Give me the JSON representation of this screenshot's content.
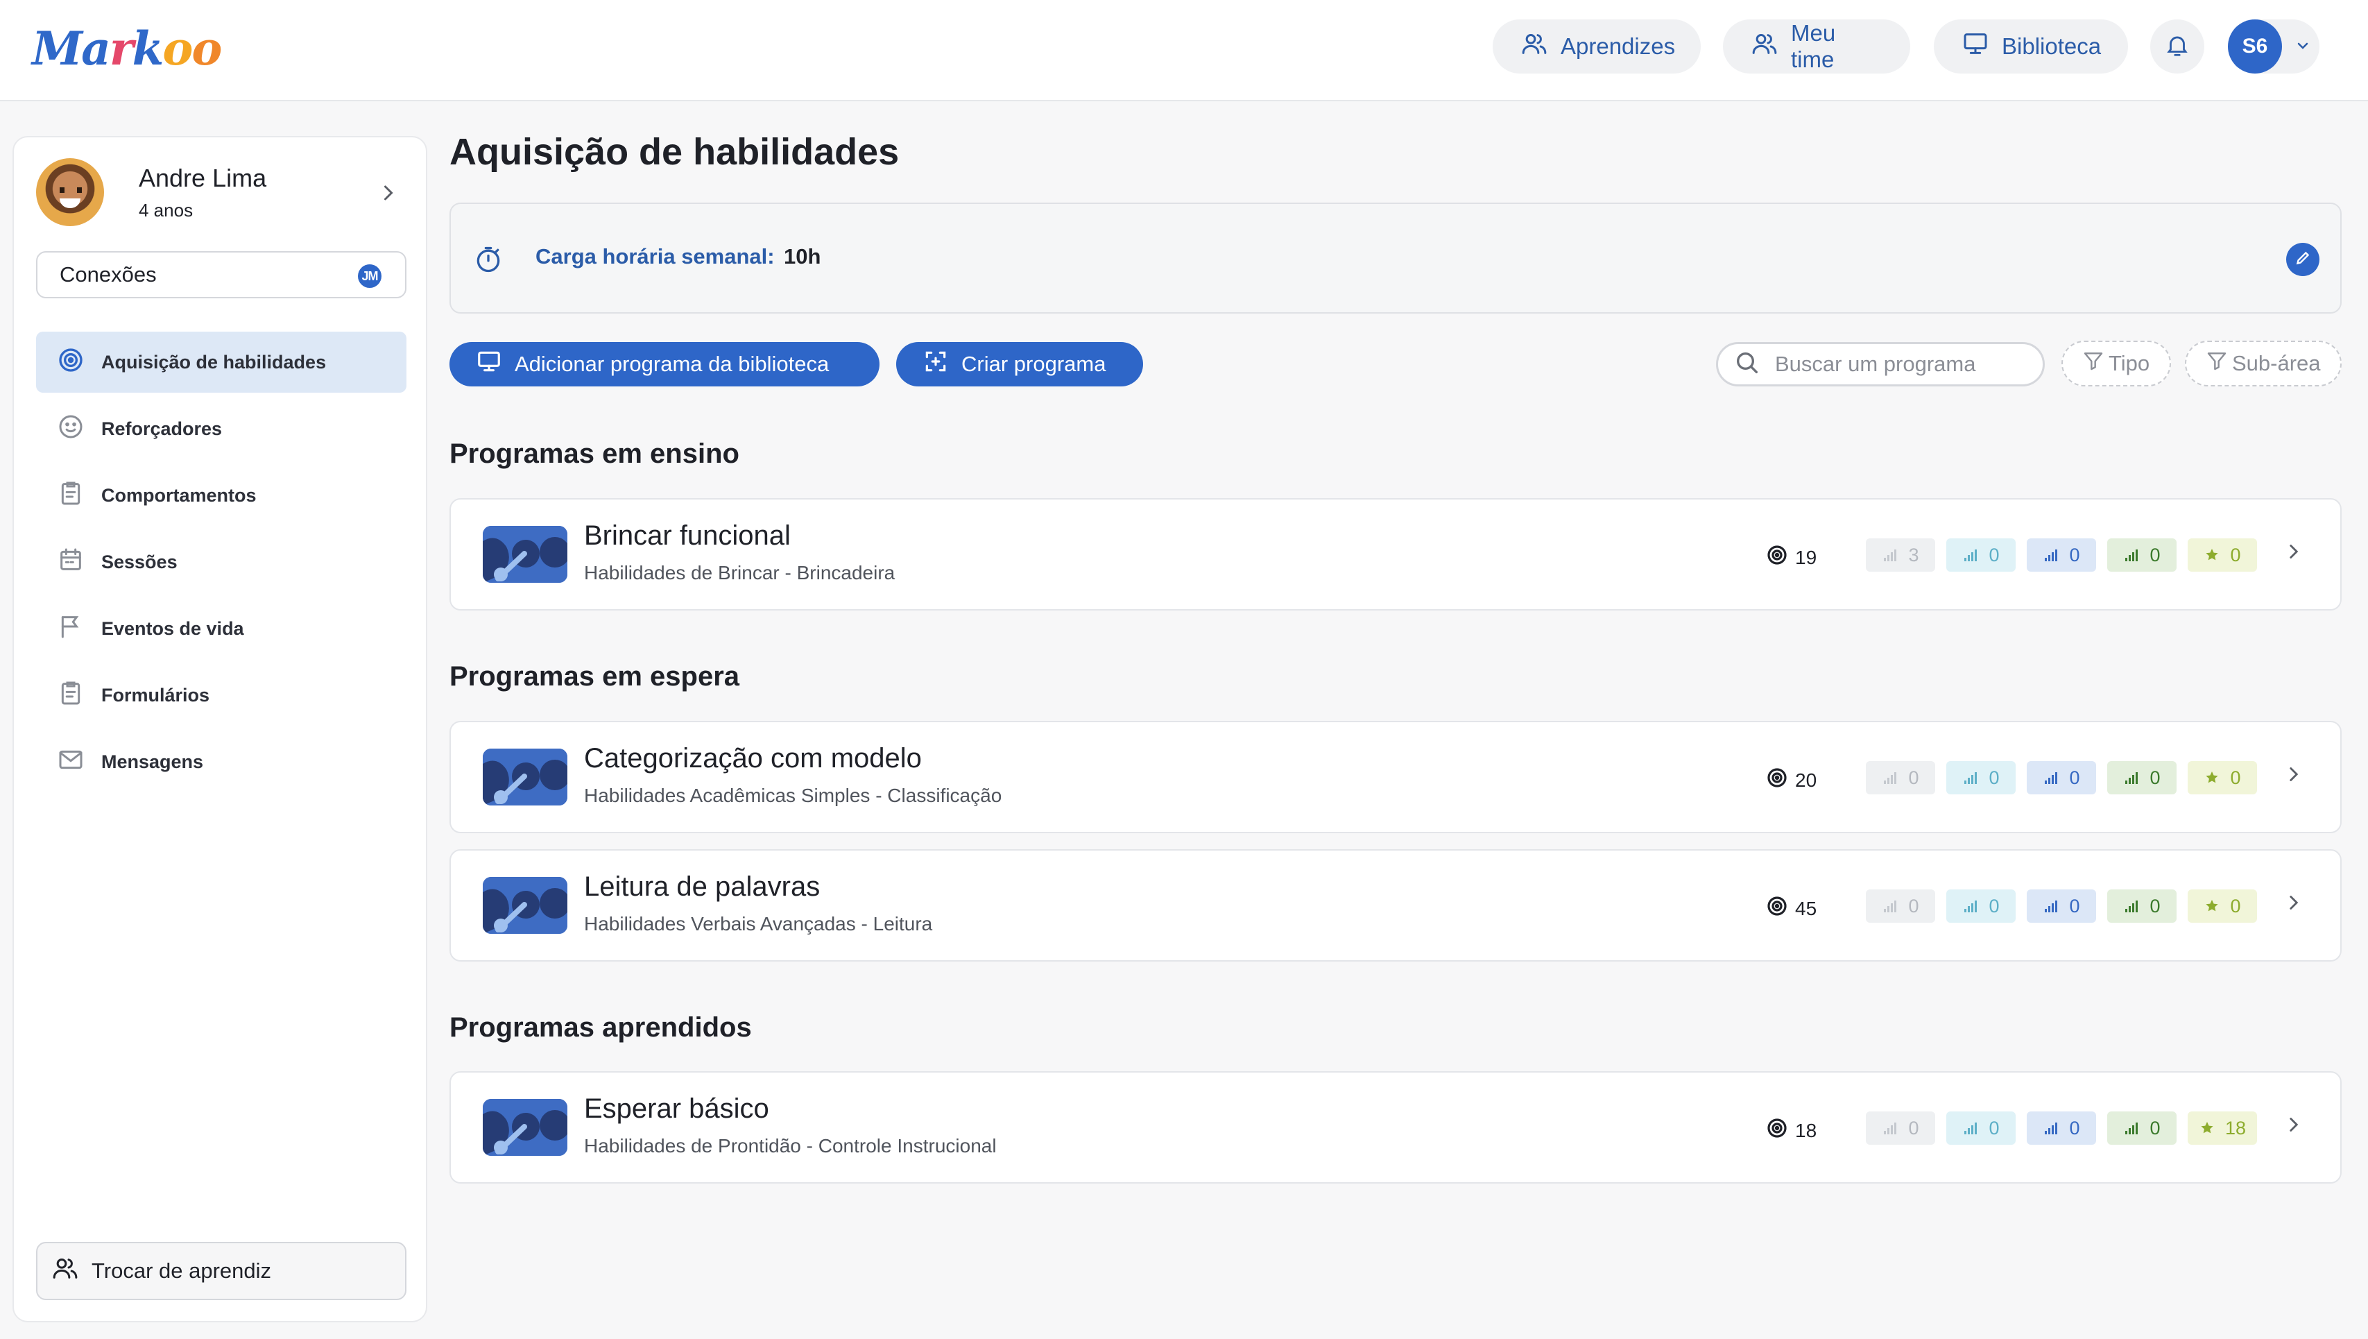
{
  "app": {
    "logo_text": "Markoo",
    "nav": {
      "learners": "Aprendizes",
      "team": "Meu time",
      "library": "Biblioteca"
    },
    "user_initials": "S6"
  },
  "sidebar": {
    "learner_name": "Andre Lima",
    "learner_age": "4 anos",
    "connections_label": "Conexões",
    "connections_badge": "JM",
    "items": [
      {
        "label": "Aquisição de habilidades",
        "icon": "target-icon",
        "active": true
      },
      {
        "label": "Reforçadores",
        "icon": "smile-icon",
        "active": false
      },
      {
        "label": "Comportamentos",
        "icon": "clipboard-icon",
        "active": false
      },
      {
        "label": "Sessões",
        "icon": "calendar-icon",
        "active": false
      },
      {
        "label": "Eventos de vida",
        "icon": "flag-icon",
        "active": false
      },
      {
        "label": "Formulários",
        "icon": "clipboard-icon",
        "active": false
      },
      {
        "label": "Mensagens",
        "icon": "mail-icon",
        "active": false
      }
    ],
    "swap_label": "Trocar de aprendiz"
  },
  "main": {
    "title": "Aquisição de habilidades",
    "weekly_hours_label": "Carga horária semanal:",
    "weekly_hours_value": "10h",
    "add_from_library": "Adicionar programa da biblioteca",
    "create_program": "Criar programa",
    "search_placeholder": "Buscar um programa",
    "filter_type": "Tipo",
    "filter_subarea": "Sub-área",
    "sections": {
      "teaching": "Programas em ensino",
      "waiting": "Programas em espera",
      "learned": "Programas aprendidos"
    },
    "programs": [
      {
        "name": "Brincar funcional",
        "area": "Habilidades de Brincar - Brincadeira",
        "targets": "19",
        "levels": [
          "3",
          "0",
          "0",
          "0",
          "0"
        ]
      },
      {
        "name": "Categorização com modelo",
        "area": "Habilidades Acadêmicas Simples - Classificação",
        "targets": "20",
        "levels": [
          "0",
          "0",
          "0",
          "0",
          "0"
        ]
      },
      {
        "name": "Leitura de palavras",
        "area": "Habilidades Verbais Avançadas - Leitura",
        "targets": "45",
        "levels": [
          "0",
          "0",
          "0",
          "0",
          "0"
        ]
      },
      {
        "name": "Esperar básico",
        "area": "Habilidades de Prontidão - Controle Instrucional",
        "targets": "18",
        "levels": [
          "0",
          "0",
          "0",
          "0",
          "18"
        ]
      }
    ]
  },
  "colors": {
    "primary": "#2e66c8",
    "active_nav_bg": "#dde8f6",
    "link_text": "#2b5ca8"
  }
}
